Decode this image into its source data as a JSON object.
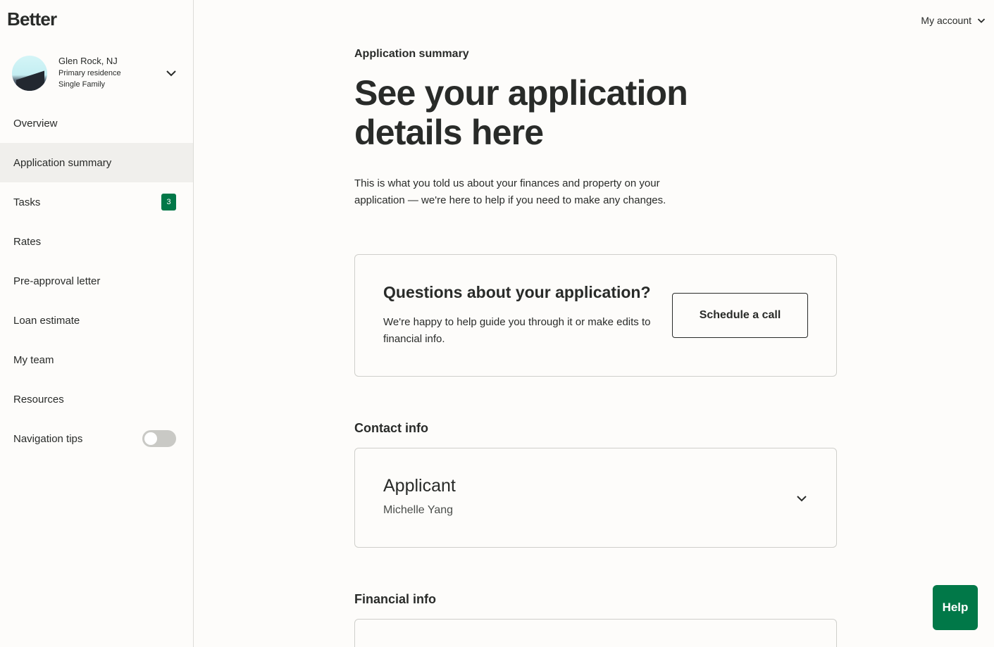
{
  "brand": {
    "logo": "Better"
  },
  "property": {
    "city": "Glen Rock, NJ",
    "usage": "Primary residence",
    "type": "Single Family"
  },
  "nav": {
    "overview": "Overview",
    "application_summary": "Application summary",
    "tasks": "Tasks",
    "tasks_badge": "3",
    "rates": "Rates",
    "preapproval": "Pre-approval letter",
    "loan_estimate": "Loan estimate",
    "my_team": "My team",
    "resources": "Resources",
    "navigation_tips": "Navigation tips",
    "navigation_tips_enabled": false
  },
  "header": {
    "account": "My account"
  },
  "main": {
    "eyebrow": "Application summary",
    "headline": "See your application details here",
    "lede": "This is what you told us about your finances and property on your application — we're here to help if you need to make any changes."
  },
  "questions_card": {
    "title": "Questions about your application?",
    "body": "We're happy to help guide you through it or make edits to financial info.",
    "button": "Schedule a call"
  },
  "contact": {
    "section_title": "Contact info",
    "role": "Applicant",
    "name": "Michelle Yang"
  },
  "financial": {
    "section_title": "Financial info"
  },
  "help_button": "Help",
  "colors": {
    "accent": "#017848",
    "text": "#292b29",
    "background": "#fdfcfa"
  }
}
